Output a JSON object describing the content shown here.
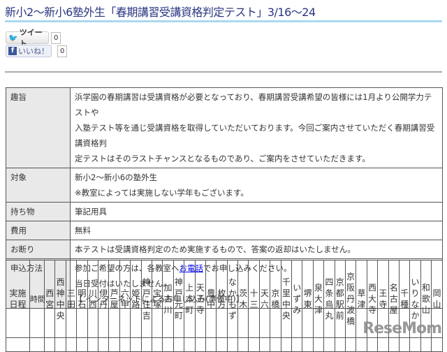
{
  "title": "新小2〜新小6塾外生「春期講習受講資格判定テスト」3/16〜24",
  "social": {
    "tweet_label": "ツイート",
    "tweet_count": "0",
    "like_label": "いいね！",
    "like_count": "0"
  },
  "info": [
    {
      "label": "趣旨",
      "lines": [
        "浜学園の春期講習は受講資格が必要となっており、春期講習受講希望の皆様には1月より公開学力テストや",
        "入塾テスト等を通じ受講資格を取得していただいております。今回ご案内させていただく春期講習受講資格判",
        "定テストはそのラストチャンスとなるものであり、ご案内をさせていただきます。"
      ]
    },
    {
      "label": "対象",
      "lines": [
        "新小2〜新小6の塾外生",
        "※教室によっては実施しない学年もございます。"
      ]
    },
    {
      "label": "持ち物",
      "lines": [
        "筆記用具"
      ]
    },
    {
      "label": "費用",
      "lines": [
        "無料"
      ]
    },
    {
      "label": "お断り",
      "lines": [
        "本テストは受講資格判定のため実施するもので、答案の返却はいたしません。"
      ]
    }
  ],
  "apply": {
    "label": "申込方法",
    "pre": "参加ご希望の方は、各教室へ",
    "link": "お電話",
    "post": "でお申し込みください。",
    "line2": "当日受付はいたしません。",
    "line3": "【 インターネットによるお申し込み(準備中)】"
  },
  "schedule": {
    "date_header": "実施日程",
    "time_header": "時間",
    "schools": [
      "西宮",
      "西神中央",
      "三田",
      "明石",
      "川西",
      "伊丹",
      "芦屋",
      "六甲",
      "姫路",
      "神戸住吉",
      "宝塚",
      "加古川",
      "神戸元町",
      "上本町",
      "天王寺",
      "豊中",
      "枚方",
      "なかもず",
      "茨木",
      "十三",
      "天六",
      "京橋",
      "千里中央",
      "いずみ",
      "堺東",
      "泉大津",
      "四条烏丸",
      "京都駅前",
      "京阪丹波橋",
      "草津",
      "西大寺",
      "王寺",
      "名古屋",
      "千種",
      "いりなか",
      "和歌山",
      "岡山"
    ]
  },
  "watermark": "ReseMom"
}
